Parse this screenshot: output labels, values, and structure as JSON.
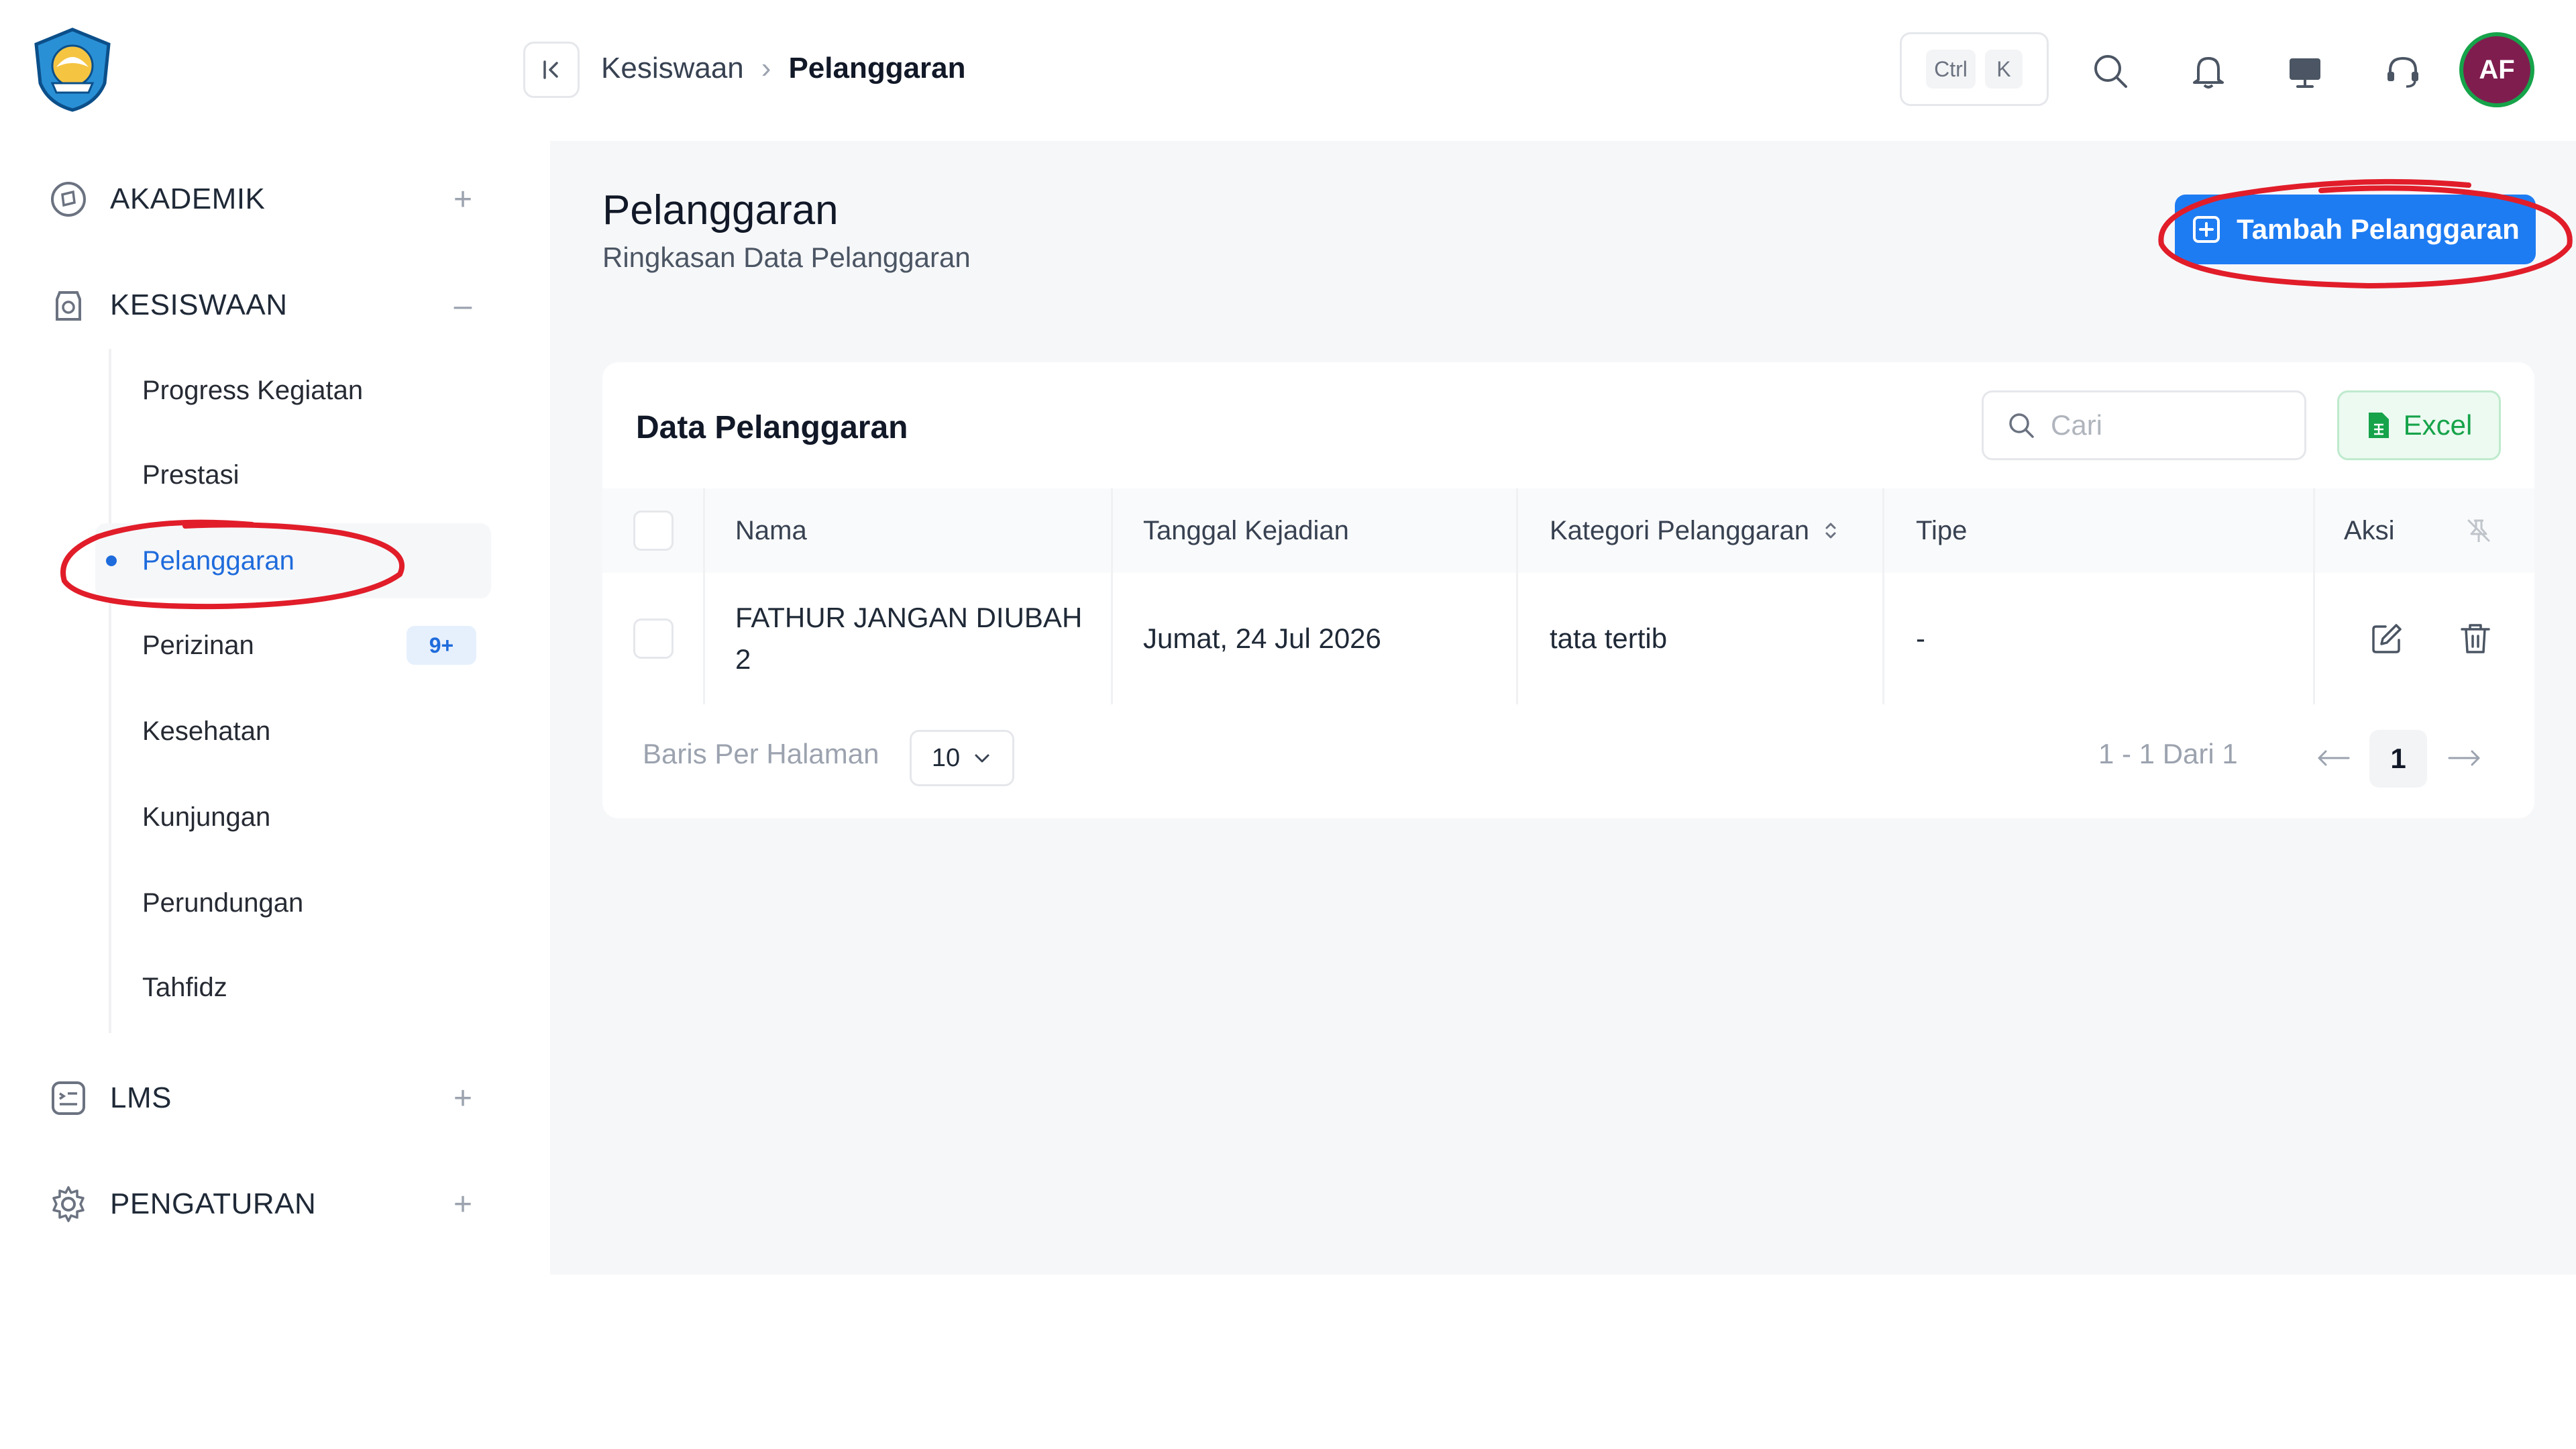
{
  "breadcrumb": {
    "parent": "Kesiswaan",
    "separator": "›",
    "current": "Pelanggaran"
  },
  "shortcut": {
    "key1": "Ctrl",
    "key2": "K"
  },
  "user": {
    "initials": "AF"
  },
  "sidebar": {
    "sections": [
      {
        "label": "AKADEMIK",
        "icon": "academic-icon",
        "toggle": "+"
      },
      {
        "label": "KESISWAAN",
        "icon": "student-icon",
        "toggle": "–"
      },
      {
        "label": "LMS",
        "icon": "lms-icon",
        "toggle": "+"
      },
      {
        "label": "PENGATURAN",
        "icon": "gear-icon",
        "toggle": "+"
      }
    ],
    "subitems": [
      {
        "label": "Progress Kegiatan",
        "active": false
      },
      {
        "label": "Prestasi",
        "active": false
      },
      {
        "label": "Pelanggaran",
        "active": true
      },
      {
        "label": "Perizinan",
        "active": false,
        "badge": "9+"
      },
      {
        "label": "Kesehatan",
        "active": false
      },
      {
        "label": "Kunjungan",
        "active": false
      },
      {
        "label": "Perundungan",
        "active": false
      },
      {
        "label": "Tahfidz",
        "active": false
      }
    ]
  },
  "page": {
    "title": "Pelanggaran",
    "subtitle": "Ringkasan Data Pelanggaran",
    "add_button": "Tambah Pelanggaran"
  },
  "card": {
    "title": "Data Pelanggaran",
    "search_placeholder": "Cari",
    "excel_button": "Excel",
    "columns": [
      "Nama",
      "Tanggal Kejadian",
      "Kategori Pelanggaran",
      "Tipe",
      "Aksi"
    ],
    "rows": [
      {
        "nama": "FATHUR JANGAN DIUBAH 2",
        "tanggal": "Jumat, 24 Jul 2026",
        "kategori": "tata tertib",
        "tipe": "-"
      }
    ],
    "rows_per_page_label": "Baris Per Halaman",
    "rows_per_page": "10",
    "range": "1 - 1 Dari 1",
    "current_page": "1"
  },
  "colors": {
    "accent": "#1e7cf2",
    "active_text": "#1e6bdc",
    "excel": "#16a34a",
    "avatar_bg": "#7f1d4f",
    "annotation": "#e11d2a"
  }
}
